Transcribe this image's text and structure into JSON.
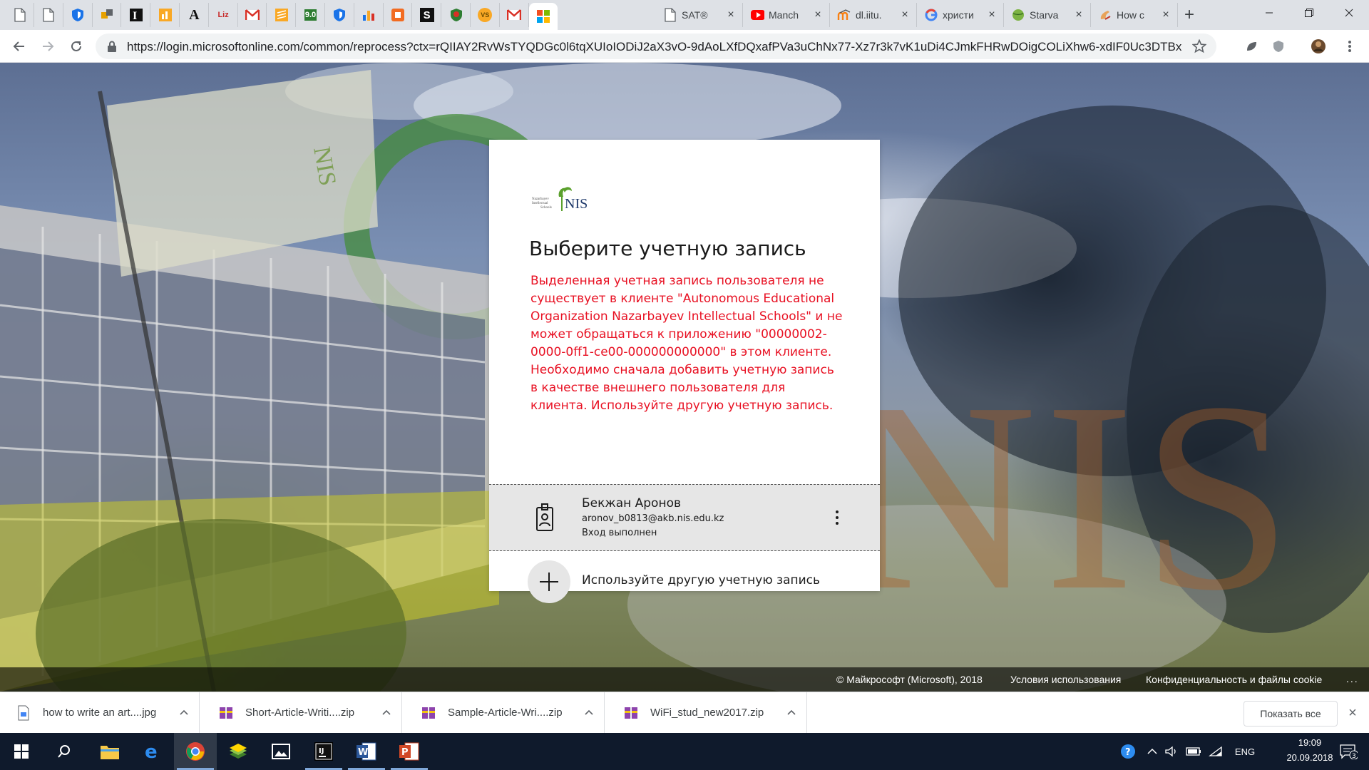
{
  "browser": {
    "pinned_tabs": [
      {
        "icon": "blank-page-icon"
      },
      {
        "icon": "blank-page-icon"
      },
      {
        "icon": "shield-icon"
      },
      {
        "icon": "puzzle-icon"
      },
      {
        "icon": "i-logo-icon"
      },
      {
        "icon": "chart-square-icon"
      },
      {
        "icon": "a-letter-icon",
        "glyph": "A"
      },
      {
        "icon": "liz-icon",
        "glyph": "Liz"
      },
      {
        "icon": "gmail-icon"
      },
      {
        "icon": "lines-icon"
      },
      {
        "icon": "score-icon",
        "glyph": "9.0"
      },
      {
        "icon": "shield-icon"
      },
      {
        "icon": "bar-chart-icon"
      },
      {
        "icon": "orange-square-icon"
      },
      {
        "icon": "s-letter-icon",
        "glyph": "S"
      },
      {
        "icon": "shield-red-icon"
      },
      {
        "icon": "vs-icon",
        "glyph": "VS"
      },
      {
        "icon": "gmail-icon"
      },
      {
        "icon": "microsoft-icon"
      }
    ],
    "tabs": [
      {
        "title": "SAT®",
        "icon": "blank-page-icon"
      },
      {
        "title": "Manch",
        "icon": "youtube-icon"
      },
      {
        "title": "dl.iitu.",
        "icon": "moodle-icon"
      },
      {
        "title": "христи",
        "icon": "google-icon"
      },
      {
        "title": "Starva",
        "icon": "ball-icon"
      },
      {
        "title": "How c",
        "icon": "hand-icon"
      }
    ],
    "url": "https://login.microsoftonline.com/common/reprocess?ctx=rQIIAY2RvWsTYQDGc0l6tqXUIoIODiJ2aX3vO-9dAoLXfDQxafPVa3uChNx77-Xz7r3k7vK1uDi4CJmkFHRwDOigCOLiXhw6-xdIF0Uc3DTBx..."
  },
  "card": {
    "logo_text": "NIS",
    "logo_small": [
      "Nazarbayev",
      "Intellectual",
      "Schools"
    ],
    "title": "Выберите учетную запись",
    "error": "Выделенная учетная запись пользователя не существует в клиенте \"Autonomous Educational Organization Nazarbayev Intellectual Schools\" и не может обращаться к приложению \"00000002-0000-0ff1-ce00-000000000000\" в этом клиенте. Необходимо сначала добавить учетную запись в качестве внешнего пользователя для клиента. Используйте другую учетную запись.",
    "account": {
      "name": "Бекжан Аронов",
      "email": "aronov_b0813@akb.nis.edu.kz",
      "status": "Вход выполнен"
    },
    "other_account": "Используйте другую учетную запись"
  },
  "background": {
    "watermark": "NIS",
    "flag_text": "NIS"
  },
  "footer": {
    "copyright": "© Майкрософт (Microsoft), 2018",
    "terms": "Условия использования",
    "privacy": "Конфиденциальность и файлы cookie",
    "more": "..."
  },
  "downloads": {
    "items": [
      {
        "name": "how to write an art....jpg",
        "icon": "image-file-icon"
      },
      {
        "name": "Short-Article-Writi....zip",
        "icon": "archive-icon"
      },
      {
        "name": "Sample-Article-Wri....zip",
        "icon": "archive-icon"
      },
      {
        "name": "WiFi_stud_new2017.zip",
        "icon": "archive-icon"
      }
    ],
    "show_all": "Показать все"
  },
  "taskbar": {
    "apps": [
      "file-explorer",
      "edge",
      "chrome",
      "bluestacks",
      "photos",
      "intellij",
      "word",
      "powerpoint"
    ],
    "tray": {
      "language": "ENG",
      "time": "19:09",
      "date": "20.09.2018",
      "notifications": "3"
    }
  },
  "colors": {
    "error": "#e81123",
    "tile_bg": "#e6e6e6",
    "taskbar": "#0f1a2c"
  }
}
